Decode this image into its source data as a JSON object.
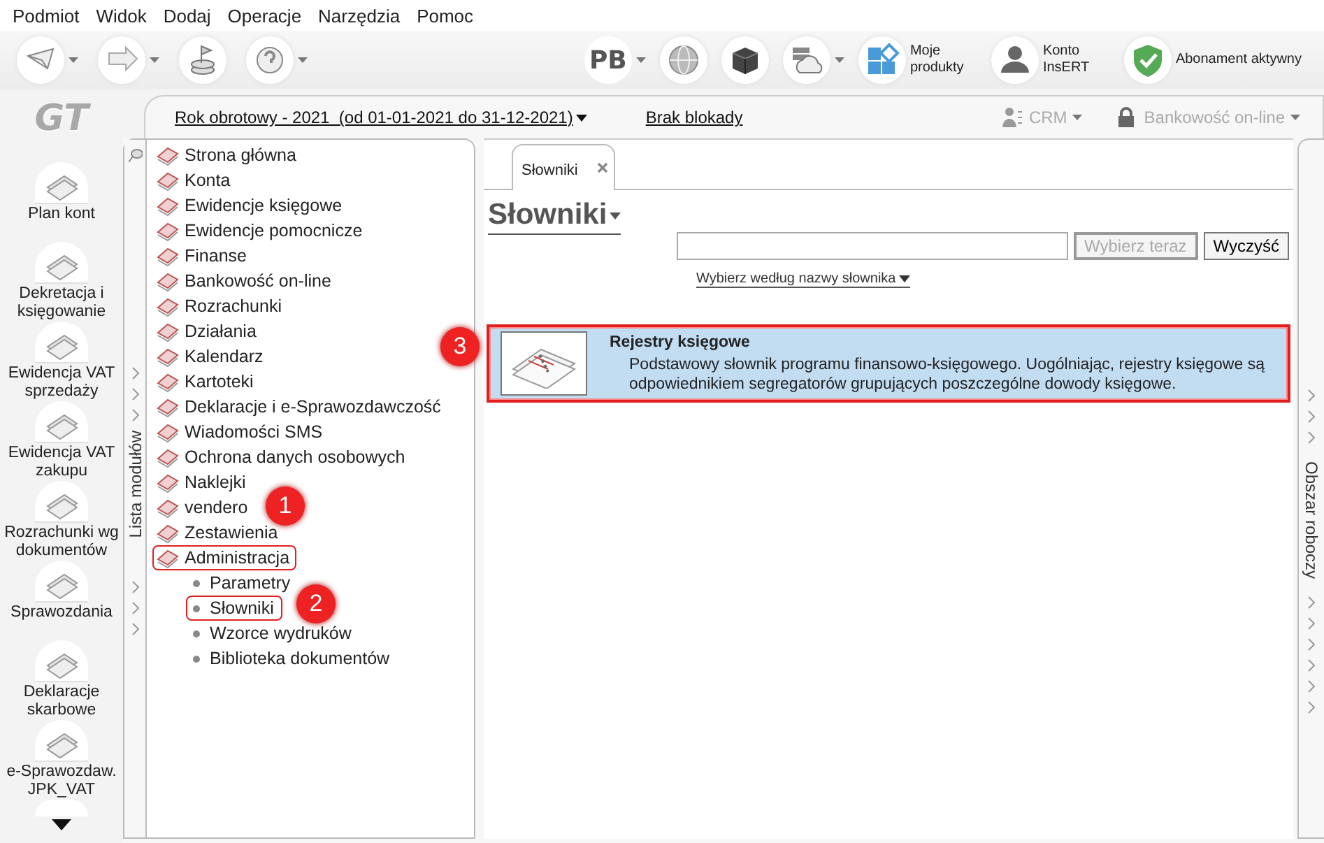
{
  "menu": [
    "Podmiot",
    "Widok",
    "Dodaj",
    "Operacje",
    "Narzędzia",
    "Pomoc"
  ],
  "toolbar": {
    "left_tools": [
      {
        "dropdown": true
      },
      {
        "dropdown": true
      },
      {
        "dropdown": false
      },
      {
        "dropdown": true
      }
    ],
    "right_tools": [
      {
        "kind": "text",
        "label": "PB",
        "dropdown": true
      },
      {
        "kind": "globe",
        "dropdown": false
      },
      {
        "kind": "cube",
        "dropdown": false
      },
      {
        "kind": "cloud",
        "dropdown": true
      },
      {
        "kind": "tiles",
        "label": "Moje produkty",
        "dropdown": false
      },
      {
        "kind": "person",
        "label": "Konto InsERT",
        "dropdown": false
      },
      {
        "kind": "shield",
        "label": "Abonament aktywny",
        "dropdown": false
      }
    ]
  },
  "logo": "GT",
  "rail": {
    "items": [
      {
        "label": "Plan kont"
      },
      {
        "label": "Dekretacja i księgowanie"
      },
      {
        "label": "Ewidencja VAT sprzedaży"
      },
      {
        "label": "Ewidencja VAT zakupu"
      },
      {
        "label": "Rozrachunki wg dokumentów"
      },
      {
        "label": "Sprawozdania"
      },
      {
        "label": "Deklaracje skarbowe"
      },
      {
        "label": "e-Sprawozdaw. JPK_VAT"
      }
    ]
  },
  "header": {
    "fiscal_year": "Rok obrotowy - 2021  (od 01-01-2021 do 31-12-2021)",
    "lock_status": "Brak blokady",
    "crm": {
      "label": "CRM",
      "disabled": true
    },
    "banking": {
      "label": "Bankowość on-line",
      "disabled": true
    }
  },
  "modules": {
    "title": "Lista modułów",
    "items": [
      {
        "label": "Strona główna",
        "highlighted": false
      },
      {
        "label": "Konta",
        "highlighted": false
      },
      {
        "label": "Ewidencje księgowe",
        "highlighted": false
      },
      {
        "label": "Ewidencje pomocnicze",
        "highlighted": false
      },
      {
        "label": "Finanse",
        "highlighted": false
      },
      {
        "label": "Bankowość on-line",
        "highlighted": false
      },
      {
        "label": "Rozrachunki",
        "highlighted": false
      },
      {
        "label": "Działania",
        "highlighted": false
      },
      {
        "label": "Kalendarz",
        "highlighted": false
      },
      {
        "label": "Kartoteki",
        "highlighted": false
      },
      {
        "label": "Deklaracje i e-Sprawozdawczość",
        "highlighted": false
      },
      {
        "label": "Wiadomości SMS",
        "highlighted": false
      },
      {
        "label": "Ochrona danych osobowych",
        "highlighted": false
      },
      {
        "label": "Naklejki",
        "highlighted": false
      },
      {
        "label": "vendero",
        "highlighted": false
      },
      {
        "label": "Zestawienia",
        "highlighted": false
      },
      {
        "label": "Administracja",
        "highlighted": true,
        "children": [
          {
            "label": "Parametry",
            "highlighted": false
          },
          {
            "label": "Słowniki",
            "highlighted": true
          },
          {
            "label": "Wzorce wydruków",
            "highlighted": false
          },
          {
            "label": "Biblioteka dokumentów",
            "highlighted": false
          }
        ]
      }
    ]
  },
  "workspace": {
    "tabs": [
      {
        "label": "Słowniki",
        "selected": true
      }
    ],
    "title": "Słowniki",
    "buttons": [
      {
        "label": "Wybierz teraz",
        "disabled": true
      },
      {
        "label": "Wyczyść",
        "disabled": false
      }
    ],
    "filter": "Wybierz według nazwy słownika",
    "entries": [
      {
        "title": "Rejestry księgowe",
        "description": "Podstawowy słownik programu finansowo-księgowego. Uogólniając, rejestry księgowe są odpowiednikiem segregatorów grupujących poszczególne dowody księgowe.",
        "highlighted": true
      }
    ]
  },
  "side_panel": {
    "title": "Obszar roboczy"
  },
  "callouts": [
    {
      "label": "1"
    },
    {
      "label": "2"
    },
    {
      "label": "3"
    }
  ]
}
